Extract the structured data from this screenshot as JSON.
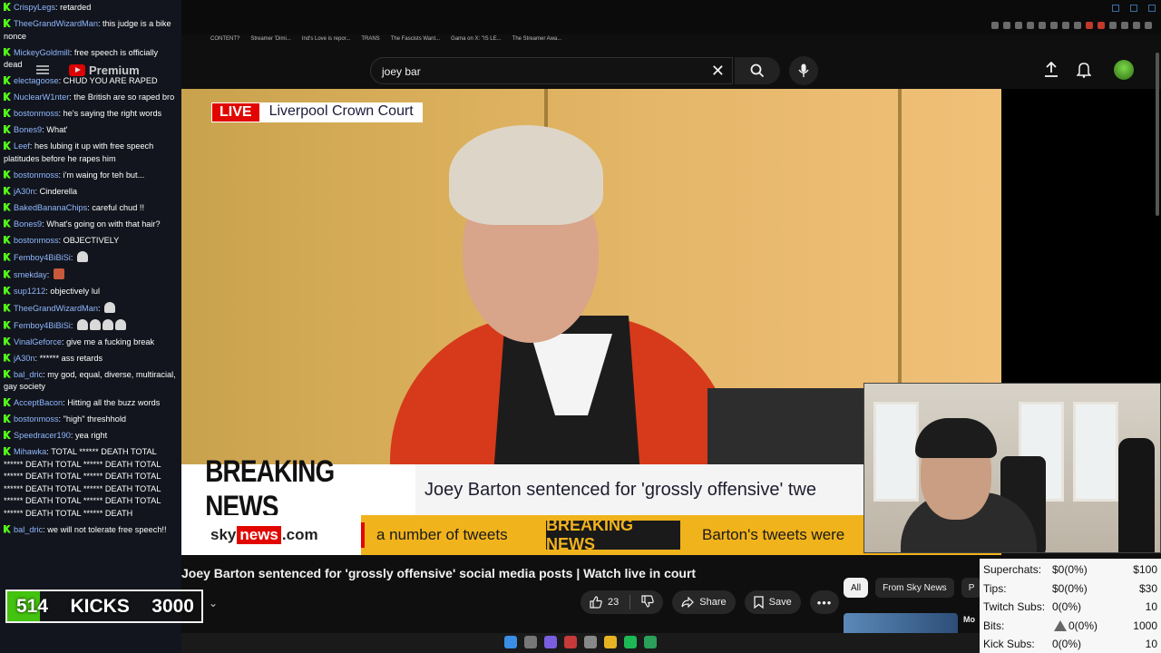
{
  "browser": {
    "bookmarks": [
      "CONTENT?",
      "Streamer 'Dimi...",
      "Ind's Love is repor...",
      "TRANS",
      "The Fascists Want...",
      "Gama on X: \"IS LE...",
      "The Streamer Awa..."
    ]
  },
  "youtube": {
    "logo_text": "Premium",
    "search_value": "joey bar",
    "video_title": "Joey Barton sentenced for 'grossly offensive' social media posts | Watch live in court",
    "like_count": "23",
    "share_label": "Share",
    "save_label": "Save",
    "filter_chips": [
      "All",
      "From Sky News",
      "P"
    ],
    "related_label": "Mo"
  },
  "broadcast": {
    "live_label": "LIVE",
    "location": "Liverpool Crown Court",
    "breaking_label": "BREAKING NEWS",
    "headline": "Joey Barton sentenced for 'grossly offensive' twe",
    "sky_prefix": "sky",
    "sky_news": "news",
    "sky_suffix": ".com",
    "ticker_text1": "a number of tweets",
    "ticker_breaking": "BREAKING NEWS",
    "ticker_text2": "Barton's tweets were"
  },
  "chat": [
    {
      "user": "CrispyLegs",
      "text": "retarded",
      "emote": ""
    },
    {
      "user": "TheeGrandWizardMan",
      "text": "this judge is a bike nonce",
      "emote": ""
    },
    {
      "user": "MickeyGoldmill",
      "text": "free speech is officially dead",
      "emote": ""
    },
    {
      "user": "electagoose",
      "text": "CHUD YOU ARE RAPED",
      "emote": ""
    },
    {
      "user": "NuclearW1nter",
      "text": "the British are so raped bro",
      "emote": ""
    },
    {
      "user": "bostonmoss",
      "text": "he's saying the right words",
      "emote": ""
    },
    {
      "user": "Bones9",
      "text": "What'",
      "emote": ""
    },
    {
      "user": "Leef",
      "text": "hes lubing it up with free speech platitudes before he rapes him",
      "emote": ""
    },
    {
      "user": "bostonmoss",
      "text": "i'm waing for teh but...",
      "emote": ""
    },
    {
      "user": "jA30n",
      "text": "Cinderella",
      "emote": ""
    },
    {
      "user": "BakedBananaChips",
      "text": "careful chud !!",
      "emote": ""
    },
    {
      "user": "Bones9",
      "text": "What's going on with that hair?",
      "emote": ""
    },
    {
      "user": "bostonmoss",
      "text": "OBJECTIVELY",
      "emote": ""
    },
    {
      "user": "Femboy4BiBiSi",
      "text": "",
      "emote": "ghost"
    },
    {
      "user": "smekday",
      "text": "",
      "emote": "face"
    },
    {
      "user": "sup1212",
      "text": "objectively lul",
      "emote": ""
    },
    {
      "user": "TheeGrandWizardMan",
      "text": "",
      "emote": "ghost"
    },
    {
      "user": "Femboy4BiBiSi",
      "text": "",
      "emote": "ghost4"
    },
    {
      "user": "VinalGeforce",
      "text": "give me a fucking break",
      "emote": ""
    },
    {
      "user": "jA30n",
      "text": "****** ass retards",
      "emote": ""
    },
    {
      "user": "bal_dric",
      "text": "my god, equal, diverse, multiracial, gay society",
      "emote": ""
    },
    {
      "user": "AcceptBacon",
      "text": "Hitting all the buzz words",
      "emote": ""
    },
    {
      "user": "bostonmoss",
      "text": "\"high\" threshhold",
      "emote": ""
    },
    {
      "user": "Speedracer190",
      "text": "yea right",
      "emote": ""
    },
    {
      "user": "Mihawka",
      "text": "TOTAL ****** DEATH TOTAL ****** DEATH TOTAL ****** DEATH TOTAL ****** DEATH TOTAL ****** DEATH TOTAL ****** DEATH TOTAL ****** DEATH TOTAL ****** DEATH TOTAL ****** DEATH TOTAL ****** DEATH TOTAL ****** DEATH",
      "emote": ""
    },
    {
      "user": "bal_dric",
      "text": "we will not tolerate free speech!!",
      "emote": ""
    }
  ],
  "kicks": {
    "current": "514",
    "label": "KICKS",
    "goal": "3000",
    "progress": 0.17
  },
  "stats": [
    {
      "label": "Superchats:",
      "value": "$0(0%)",
      "goal": "$100",
      "warn": false
    },
    {
      "label": "Tips:",
      "value": "$0(0%)",
      "goal": "$30",
      "warn": false
    },
    {
      "label": "Twitch Subs:",
      "value": "0(0%)",
      "goal": "10",
      "warn": false
    },
    {
      "label": "Bits:",
      "value": "0(0%)",
      "goal": "1000",
      "warn": true
    },
    {
      "label": "Kick Subs:",
      "value": "0(0%)",
      "goal": "10",
      "warn": false
    }
  ],
  "colors": {
    "kick_green": "#53fc18",
    "sky_red": "#e10600",
    "ticker_yellow": "#f1b31c"
  }
}
